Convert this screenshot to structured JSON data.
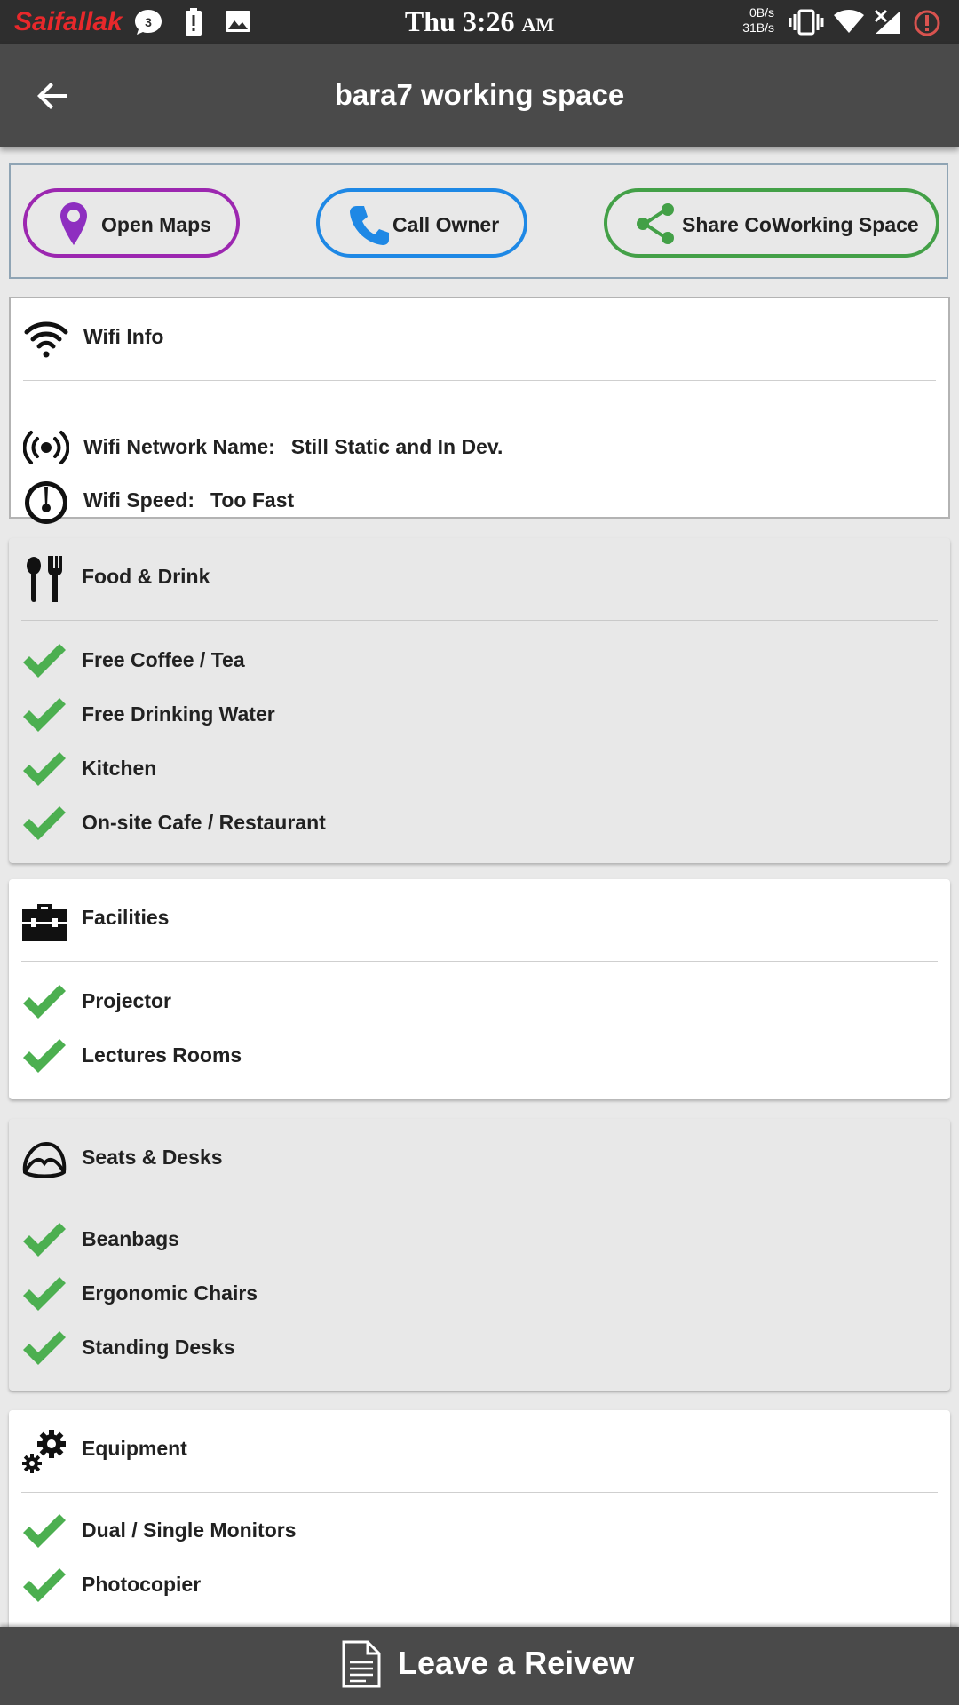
{
  "status_bar": {
    "carrier": "Saifallak",
    "notification_count": "3",
    "time": "Thu 3:26",
    "ampm": "AM",
    "net_down": "0B/s",
    "net_up": "31B/s"
  },
  "app_bar": {
    "title": "bara7 working space"
  },
  "actions": {
    "open_maps": "Open Maps",
    "call_owner": "Call Owner",
    "share": "Share CoWorking Space",
    "colors": {
      "maps": "#9c27b0",
      "call": "#1e88e5",
      "share": "#43a047"
    }
  },
  "wifi": {
    "title": "Wifi Info",
    "network_label": "Wifi Network Name:",
    "network_value": "Still Static and In Dev.",
    "speed_label": "Wifi Speed:",
    "speed_value": "Too Fast"
  },
  "food": {
    "title": "Food & Drink",
    "items": [
      "Free Coffee / Tea",
      "Free Drinking Water",
      "Kitchen",
      "On-site Cafe / Restaurant"
    ]
  },
  "facilities": {
    "title": "Facilities",
    "items": [
      "Projector",
      "Lectures Rooms"
    ]
  },
  "seats": {
    "title": "Seats & Desks",
    "items": [
      "Beanbags",
      "Ergonomic Chairs",
      "Standing Desks"
    ]
  },
  "equipment": {
    "title": "Equipment",
    "items": [
      "Dual / Single Monitors",
      "Photocopier"
    ]
  },
  "bottom_bar": {
    "label": "Leave a Reivew"
  },
  "check_color": "#4caf50"
}
